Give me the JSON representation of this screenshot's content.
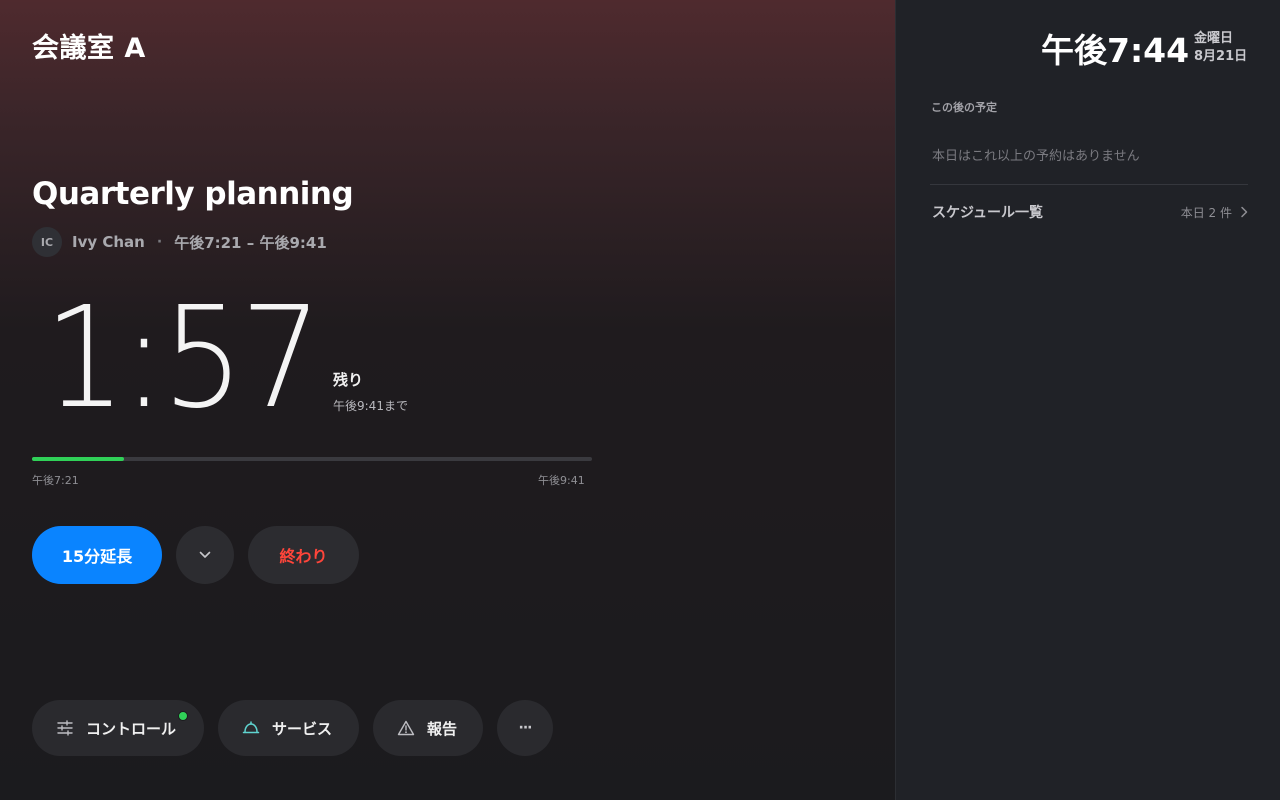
{
  "room": {
    "name": "会議室 A"
  },
  "meeting": {
    "title": "Quarterly planning",
    "organizer_initials": "IC",
    "organizer_name": "Ivy Chan",
    "separator": "·",
    "time_range": "午後7:21 – 午後9:41"
  },
  "countdown": {
    "value": "1:57",
    "remaining_label": "残り",
    "until_label": "午後9:41まで"
  },
  "progress": {
    "fraction": 0.164,
    "start_label": "午後7:21",
    "end_label": "午後9:41",
    "color": "#30d158"
  },
  "actions": {
    "extend_label": "15分延長",
    "end_label": "終わり",
    "extend_color": "#0a84ff",
    "end_color": "#ff453a"
  },
  "quick_actions": {
    "controls_label": "コントロール",
    "service_label": "サービス",
    "report_label": "報告",
    "more_glyph": "···",
    "controls_status_color": "#30d158"
  },
  "sidebar": {
    "clock": "午後7:44",
    "day_of_week": "金曜日",
    "date": "8月21日",
    "upcoming_heading": "この後の予定",
    "upcoming_empty": "本日はこれ以上の予約はありません",
    "schedule_label": "スケジュール一覧",
    "schedule_count": "本日 2 件"
  },
  "icons": {
    "chevron_down": "chevron-down-icon",
    "sliders": "sliders-icon",
    "service_bell": "service-bell-icon",
    "warning": "warning-triangle-icon",
    "chevron_right": "chevron-right-icon"
  }
}
